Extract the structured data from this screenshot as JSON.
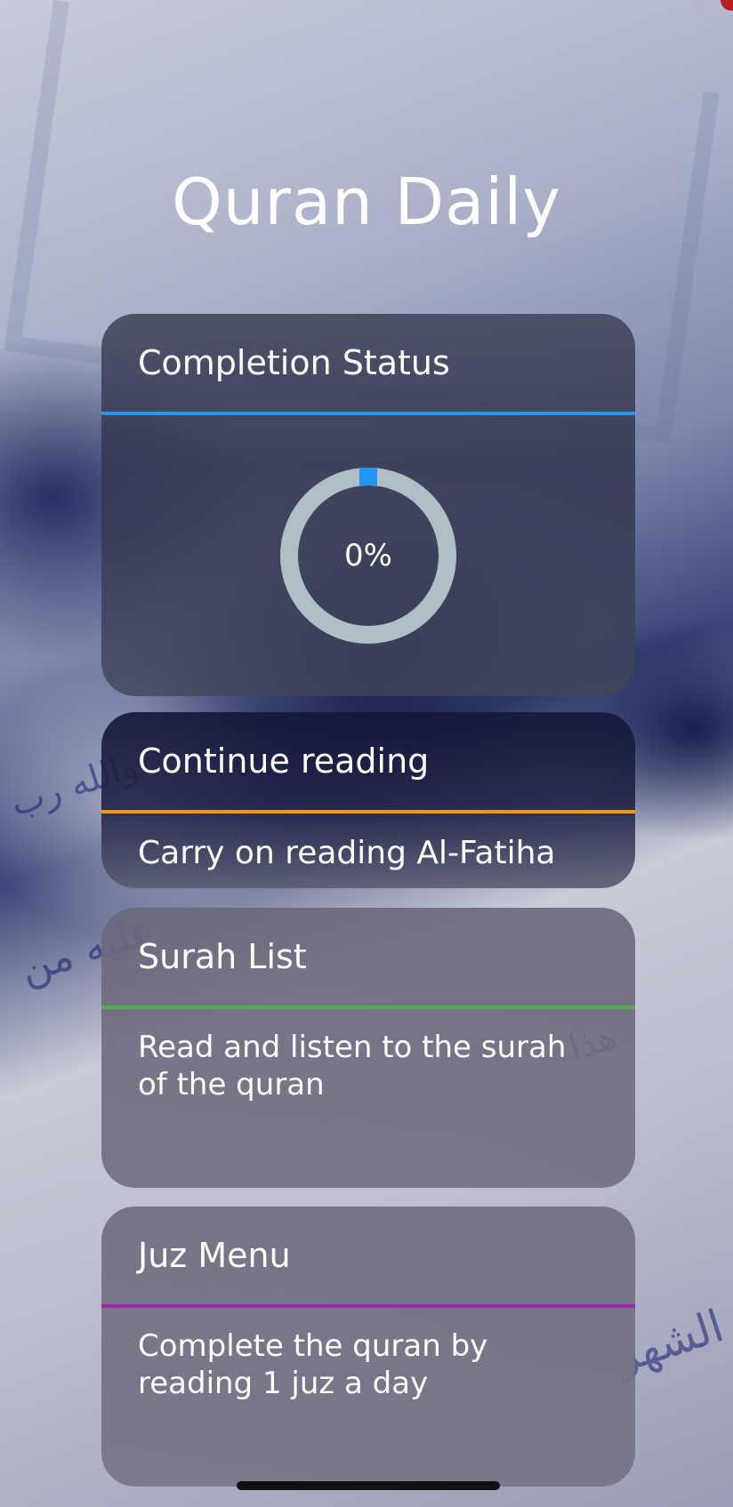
{
  "app": {
    "title": "Quran Daily"
  },
  "cards": {
    "status": {
      "title": "Completion Status",
      "progress_text": "0%",
      "progress": 0,
      "accent": "#2196F3"
    },
    "continue": {
      "title": "Continue reading",
      "description": "Carry on reading Al-Fatiha",
      "accent": "#FF9800"
    },
    "surah": {
      "title": "Surah List",
      "description": "Read and listen to the surah of the quran",
      "accent": "#4CAF50"
    },
    "juz": {
      "title": "Juz Menu",
      "description": "Complete the quran by reading 1 juz a day",
      "accent": "#9C27B0"
    }
  },
  "colors": {
    "ring_track": "#B0BEC5",
    "ring_progress": "#2196F3"
  }
}
